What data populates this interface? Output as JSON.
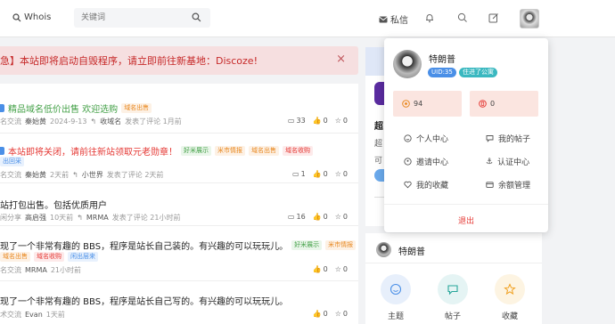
{
  "header": {
    "whois_label": "Whois",
    "search_placeholder": "关键词",
    "pm_label": "私信"
  },
  "alert": {
    "text": "急】本站即将启动自毁程序，请立即前往新基地：Discoze!",
    "close": "×"
  },
  "posts": [
    {
      "title": "精品域名低价出售 欢迎选购",
      "tags": [
        {
          "label": "域名出售",
          "color": "#e8871e",
          "bg": "#fdf1e5"
        }
      ],
      "category": "名交流",
      "author": "秦始黄",
      "time": "2024-9-13",
      "replier": "收域名",
      "activity": "发表了评论 1月前",
      "comments": "33",
      "likes": "0",
      "favs": "0"
    },
    {
      "title": "本站即将关闭，请前往新站领取元老勋章！",
      "tags": [
        {
          "label": "好米展示",
          "color": "#43a047",
          "bg": "#eaf6ea"
        },
        {
          "label": "米市情报",
          "color": "#e8871e",
          "bg": "#fdf1e5"
        },
        {
          "label": "域名出售",
          "color": "#e8871e",
          "bg": "#fdf1e5"
        },
        {
          "label": "域名收购",
          "color": "#e53935",
          "bg": "#fdeaea"
        },
        {
          "label": "出回采",
          "color": "#4a8fe7",
          "bg": "#e8f1fd"
        }
      ],
      "category": "名交流",
      "author": "秦始黄",
      "time": "2天前",
      "replier": "小世界",
      "activity": "发表了评论 2天前",
      "comments": "1",
      "likes": "0",
      "favs": "0"
    },
    {
      "title": "站打包出售。包括优质用户",
      "tags": [],
      "category": "闲分享",
      "author": "高启强",
      "time": "10天前",
      "replier": "MRMA",
      "activity": "发表了评论 21小时前",
      "comments": "16",
      "likes": "0",
      "favs": "0"
    },
    {
      "title": "现了一个非常有趣的 BBS，程序是站长自己装的。有兴趣的可以玩玩儿。",
      "tags": [
        {
          "label": "好米展示",
          "color": "#43a047",
          "bg": "#eaf6ea"
        },
        {
          "label": "米市情报",
          "color": "#e8871e",
          "bg": "#fdf1e5"
        },
        {
          "label": "域名出售",
          "color": "#e8871e",
          "bg": "#fdf1e5"
        },
        {
          "label": "域名收购",
          "color": "#e53935",
          "bg": "#fdeaea"
        },
        {
          "label": "闲出层来",
          "color": "#4a8fe7",
          "bg": "#e8f1fd"
        }
      ],
      "category": "名交流",
      "author": "MRMA",
      "time": "21小时前",
      "replier": "",
      "activity": "",
      "comments": "",
      "likes": "0",
      "favs": "0"
    },
    {
      "title": "现了一个非常有趣的 BBS，程序是站长自己写的。有兴趣的可以玩玩儿。",
      "tags": [],
      "category": "术交流",
      "author": "Evan",
      "time": "1天前",
      "replier": "",
      "activity": "",
      "comments": "",
      "likes": "0",
      "favs": "0"
    }
  ],
  "dropdown": {
    "name": "特朗普",
    "uid": "UID:35",
    "badge": "住进了公寓",
    "coins": "94",
    "points": "0",
    "menu": [
      "个人中心",
      "我的帖子",
      "邀请中心",
      "认证中心",
      "我的收藏",
      "余额管理"
    ],
    "logout": "退出"
  },
  "side2": {
    "name": "特朗普",
    "items": [
      "主题",
      "帖子",
      "收藏"
    ]
  },
  "peek": {
    "t1": "超",
    "t2": "超",
    "t3": "可"
  },
  "colors": {
    "accent": "#4a8fe7",
    "danger": "#e53935",
    "alert_bg": "#f6dfe0"
  }
}
